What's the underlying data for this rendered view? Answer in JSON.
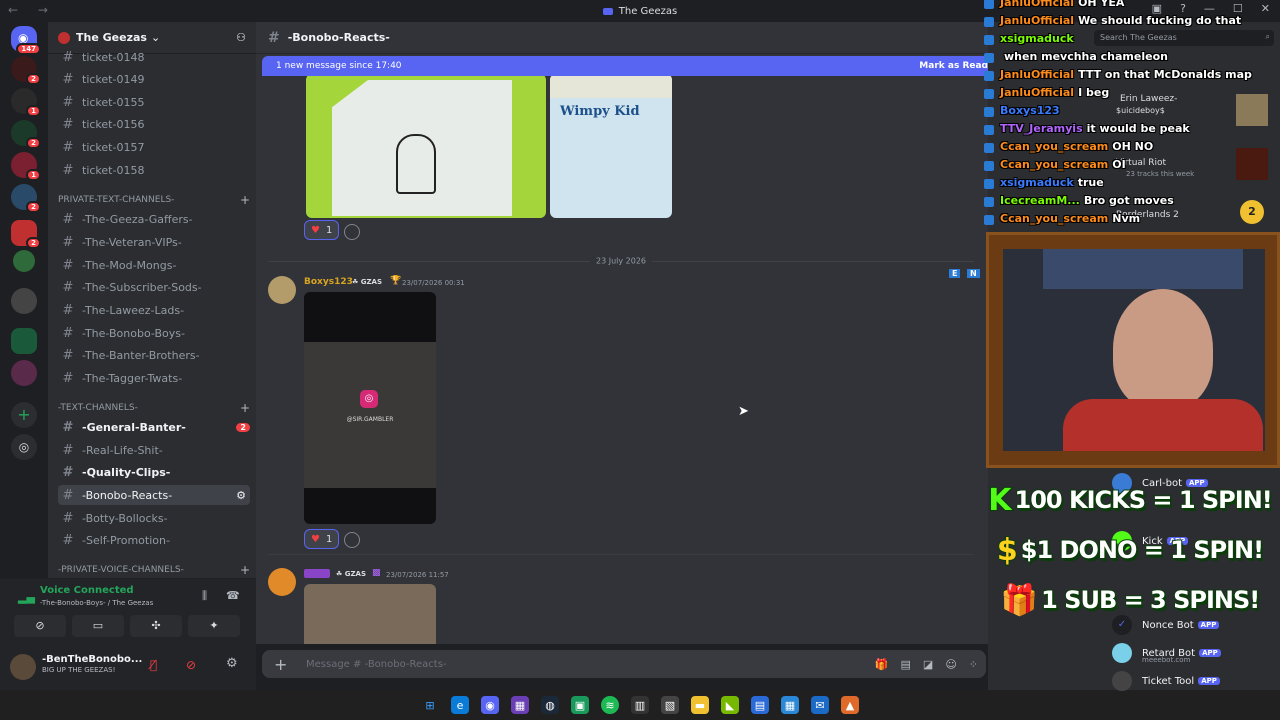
{
  "window": {
    "title": "The Geezas"
  },
  "servers": {
    "home_badge": "147",
    "badges": [
      "2",
      "1",
      "2",
      "1",
      "2",
      "2"
    ]
  },
  "guild": {
    "name": "The Geezas"
  },
  "channels": {
    "tickets": [
      "ticket-0148",
      "ticket-0149",
      "ticket-0155",
      "ticket-0156",
      "ticket-0157",
      "ticket-0158"
    ],
    "private_category": "PRIVATE-TEXT-CHANNELS-",
    "private": [
      "-The-Geeza-Gaffers-",
      "-The-Veteran-VIPs-",
      "-The-Mod-Mongs-",
      "-The-Subscriber-Sods-",
      "-The-Laweez-Lads-",
      "-The-Bonobo-Boys-",
      "-The-Banter-Brothers-",
      "-The-Tagger-Twats-"
    ],
    "text_category": "-TEXT-CHANNELS-",
    "text": [
      {
        "name": "-General-Banter-",
        "mention": "2",
        "bold": true
      },
      {
        "name": "-Real-Life-Shit-",
        "bold": false
      },
      {
        "name": "-Quality-Clips-",
        "bold": true
      },
      {
        "name": "-Bonobo-Reacts-",
        "selected": true
      },
      {
        "name": "-Botty-Bollocks-",
        "bold": false
      },
      {
        "name": "-Self-Promotion-",
        "bold": false
      }
    ],
    "voice_category": "-PRIVATE-VOICE-CHANNELS-"
  },
  "voice": {
    "status": "Voice Connected",
    "channel": "-The-Bonobo-Boys- / The Geezas"
  },
  "user": {
    "name": "-BenTheBonobo...",
    "status": "BIG UP THE GEEZAS!"
  },
  "chat": {
    "channel": "-Bonobo-Reacts-",
    "new_messages": "1 new message since 17:40",
    "mark_read": "Mark as Read",
    "date_divider": "23 July 2026",
    "reaction_count": "1",
    "msg1": {
      "author": "Boxys123",
      "tag": "GZAS",
      "time": "23/07/2026 00:31",
      "video_handle": "@SIR.GAMBLER"
    },
    "msg2": {
      "tag": "GZAS",
      "time": "23/07/2026 11:57"
    },
    "composer_placeholder": "Message # -Bonobo-Reacts-"
  },
  "overlay_chat": [
    {
      "name": "JanluOfficial",
      "msg": "OH YEA",
      "color": "#ff8c1a"
    },
    {
      "name": "JanluOfficial",
      "msg": "We should fucking do that",
      "color": "#ff8c1a"
    },
    {
      "name": "xsigmaduck",
      "msg": "",
      "color": "#7cfc00"
    },
    {
      "name": "",
      "msg": "when mevchha chameleon",
      "color": "#ff8c1a"
    },
    {
      "name": "JanluOfficial",
      "msg": "TTT on that McDonalds map",
      "color": "#ff8c1a"
    },
    {
      "name": "JanluOfficial",
      "msg": "I beg",
      "color": "#ff8c1a"
    },
    {
      "name": "Boxys123",
      "msg": "",
      "color": "#3a7bff"
    },
    {
      "name": "TTV_Jeramyis",
      "msg": "it would be peak",
      "color": "#b266ff"
    },
    {
      "name": "Ccan_you_scream",
      "msg": "OH NO",
      "color": "#ff8c1a"
    },
    {
      "name": "Ccan_you_scream",
      "msg": "OI",
      "color": "#ff8c1a"
    },
    {
      "name": "xsigmaduck",
      "msg": "true",
      "color": "#3a7bff"
    },
    {
      "name": "IcecreamM...",
      "msg": "Bro got moves",
      "color": "#7cfc00"
    },
    {
      "name": "Ccan_you_scream",
      "msg": "Nvm",
      "color": "#ff8c1a"
    }
  ],
  "search_placeholder": "Search The Geezas",
  "activity": [
    {
      "name": "Erin Laweez-",
      "sub": "$uicideboy$"
    },
    {
      "name": "Virtual Riot",
      "sub": "23 tracks this week"
    },
    {
      "name": "Borderlands 2",
      "sub": ""
    }
  ],
  "promos": [
    {
      "icon": "K",
      "text": "100 KICKS = 1 SPIN!"
    },
    {
      "icon": "$",
      "text": "$1 DONO = 1 SPIN!"
    },
    {
      "icon": "gift",
      "text": "1 SUB = 3 SPINS!"
    }
  ],
  "members": [
    {
      "name": "Carl-bot",
      "app": "APP",
      "sub": "Playing battles"
    },
    {
      "name": "Kick",
      "app": "APP",
      "sub": "Reply @Mention"
    },
    {
      "name": "Nonce Bot",
      "app": "APP",
      "sub": ""
    },
    {
      "name": "Retard Bot",
      "app": "APP",
      "sub": "meeebot.com"
    },
    {
      "name": "Ticket Tool",
      "app": "APP",
      "sub": ""
    }
  ],
  "colors": {
    "accent": "#5865f2",
    "mention": "#f23f43",
    "bg": "#313338",
    "sidebar": "#2b2d31"
  }
}
